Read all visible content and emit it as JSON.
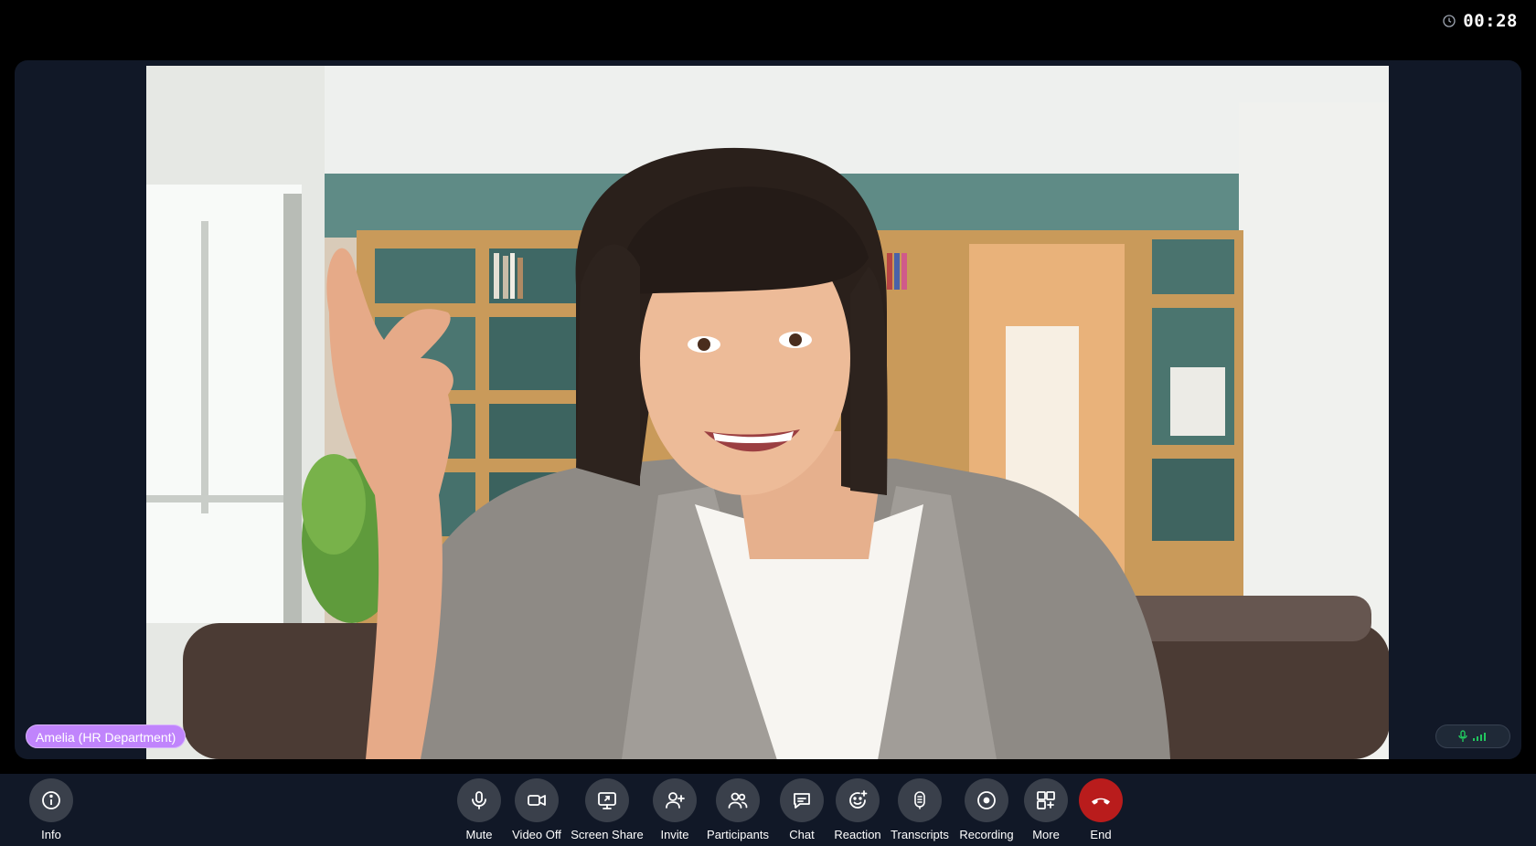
{
  "timer": {
    "elapsed": "00:28",
    "icon": "clock-icon"
  },
  "participant": {
    "name": "Amelia (HR Department)",
    "tag_color": "#c084fc",
    "audio_icon": "microphone-icon",
    "signal_icon": "signal-bars-icon"
  },
  "toolbar": {
    "info": {
      "label": "Info",
      "icon": "info-icon"
    },
    "controls": [
      {
        "label": "Mute",
        "icon": "microphone-icon"
      },
      {
        "label": "Video Off",
        "icon": "video-camera-icon"
      },
      {
        "label": "Screen Share",
        "icon": "screen-share-icon"
      },
      {
        "label": "Invite",
        "icon": "add-user-icon"
      },
      {
        "label": "Participants",
        "icon": "participants-icon"
      },
      {
        "label": "Chat",
        "icon": "chat-bubble-icon"
      },
      {
        "label": "Reaction",
        "icon": "add-reaction-icon"
      },
      {
        "label": "Transcripts",
        "icon": "transcripts-icon"
      },
      {
        "label": "Recording",
        "icon": "record-icon"
      },
      {
        "label": "More",
        "icon": "more-apps-icon"
      },
      {
        "label": "End",
        "icon": "hang-up-icon"
      }
    ]
  },
  "colors": {
    "background": "#000000",
    "panel": "#111827",
    "button": "#3a404b",
    "end_button": "#b91c1c",
    "accent_green": "#22c55e"
  }
}
